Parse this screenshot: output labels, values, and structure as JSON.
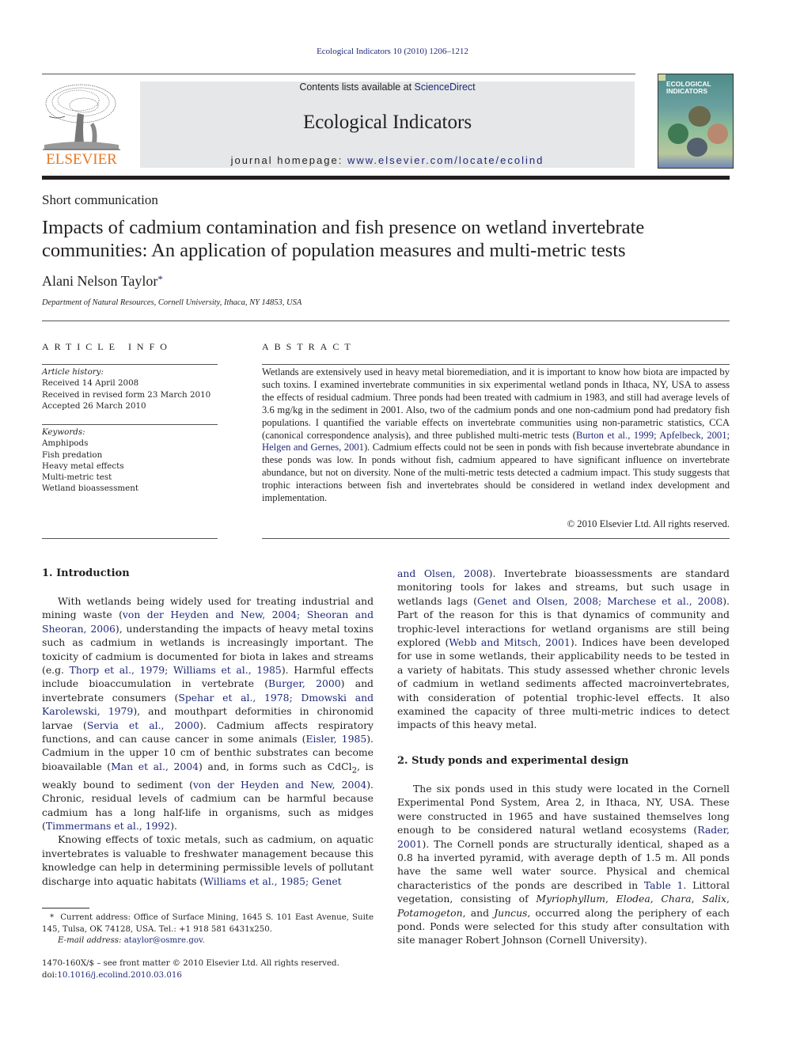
{
  "running_head": "Ecological Indicators 10 (2010) 1206–1212",
  "banner": {
    "publisher_logo_text": "ELSEVIER",
    "contents_prefix": "Contents lists available at ",
    "contents_link": "ScienceDirect",
    "journal_title": "Ecological Indicators",
    "homepage_prefix": "journal homepage: ",
    "homepage_url": "www.elsevier.com/locate/ecolind",
    "cover_title_line1": "ECOLOGICAL",
    "cover_title_line2": "INDICATORS"
  },
  "article": {
    "type": "Short communication",
    "title": "Impacts of cadmium contamination and fish presence on wetland invertebrate communities: An application of population measures and multi-metric tests",
    "author": "Alani Nelson Taylor",
    "author_mark": "*",
    "affiliation": "Department of Natural Resources, Cornell University, Ithaca, NY 14853, USA"
  },
  "article_info": {
    "heading": "ARTICLE INFO",
    "history_label": "Article history:",
    "history": [
      "Received 14 April 2008",
      "Received in revised form 23 March 2010",
      "Accepted 26 March 2010"
    ],
    "keywords_label": "Keywords:",
    "keywords": [
      "Amphipods",
      "Fish predation",
      "Heavy metal effects",
      "Multi-metric test",
      "Wetland bioassessment"
    ]
  },
  "abstract": {
    "heading": "ABSTRACT",
    "part1": "Wetlands are extensively used in heavy metal bioremediation, and it is important to know how biota are impacted by such toxins. I examined invertebrate communities in six experimental wetland ponds in Ithaca, NY, USA to assess the effects of residual cadmium. Three ponds had been treated with cadmium in 1983, and still had average levels of 3.6 mg/kg in the sediment in 2001. Also, two of the cadmium ponds and one non-cadmium pond had predatory fish populations. I quantified the variable effects on invertebrate communities using non-parametric statistics, CCA (canonical correspondence analysis), and three published multi-metric tests (",
    "cite1": "Burton et al., 1999; Apfelbeck, 2001; Helgen and Gernes, 2001",
    "part2": "). Cadmium effects could not be seen in ponds with fish because invertebrate abundance in these ponds was low. In ponds without fish, cadmium appeared to have significant influence on invertebrate abundance, but not on diversity. None of the multi-metric tests detected a cadmium impact. This study suggests that trophic interactions between fish and invertebrates should be considered in wetland index development and implementation.",
    "copyright": "© 2010 Elsevier Ltd. All rights reserved."
  },
  "section1": {
    "heading": "1.  Introduction",
    "p1": [
      {
        "t": "With wetlands being widely used for treating industrial and mining waste ("
      },
      {
        "c": "von der Heyden and New, 2004; Sheoran and Sheoran, 2006"
      },
      {
        "t": "), understanding the impacts of heavy metal toxins such as cadmium in wetlands is increasingly important. The toxicity of cadmium is documented for biota in lakes and streams (e.g. "
      },
      {
        "c": "Thorp et al., 1979; Williams et al., 1985"
      },
      {
        "t": "). Harmful effects include bioaccumulation in vertebrate ("
      },
      {
        "c": "Burger, 2000"
      },
      {
        "t": ") and invertebrate consumers ("
      },
      {
        "c": "Spehar et al., 1978; Dmowski and Karolewski, 1979"
      },
      {
        "t": "), and mouthpart deformities in chironomid larvae ("
      },
      {
        "c": "Servia et al., 2000"
      },
      {
        "t": "). Cadmium affects respiratory functions, and can cause cancer in some animals ("
      },
      {
        "c": "Eisler, 1985"
      },
      {
        "t": "). Cadmium in the upper 10 cm of benthic substrates can become bioavailable ("
      },
      {
        "c": "Man et al., 2004"
      },
      {
        "t": ") and, in forms such as CdCl"
      },
      {
        "sub": "2"
      },
      {
        "t": ", is weakly bound to sediment ("
      },
      {
        "c": "von der Heyden and New, 2004"
      },
      {
        "t": "). Chronic, residual levels of cadmium can be harmful because cadmium has a long half-life in organisms, such as midges ("
      },
      {
        "c": "Timmermans et al., 1992"
      },
      {
        "t": ")."
      }
    ],
    "p2": [
      {
        "t": "Knowing effects of toxic metals, such as cadmium, on aquatic invertebrates is valuable to freshwater management because this knowledge can help in determining permissible levels of pollutant discharge into aquatic habitats ("
      },
      {
        "c": "Williams et al., 1985; Genet"
      }
    ],
    "p2_cont": [
      {
        "c": "and Olsen, 2008"
      },
      {
        "t": "). Invertebrate bioassessments are standard monitoring tools for lakes and streams, but such usage in wetlands lags ("
      },
      {
        "c": "Genet and Olsen, 2008; Marchese et al., 2008"
      },
      {
        "t": "). Part of the reason for this is that dynamics of community and trophic-level interactions for wetland organisms are still being explored ("
      },
      {
        "c": "Webb and Mitsch, 2001"
      },
      {
        "t": "). Indices have been developed for use in some wetlands, their applicability needs to be tested in a variety of habitats. This study assessed whether chronic levels of cadmium in wetland sediments affected macroinvertebrates, with consideration of potential trophic-level effects. It also examined the capacity of three multi-metric indices to detect impacts of this heavy metal."
      }
    ]
  },
  "section2": {
    "heading": "2.  Study ponds and experimental design",
    "p1": [
      {
        "t": "The six ponds used in this study were located in the Cornell Experimental Pond System, Area 2, in Ithaca, NY, USA. These were constructed in 1965 and have sustained themselves long enough to be considered natural wetland ecosystems ("
      },
      {
        "c": "Rader, 2001"
      },
      {
        "t": "). The Cornell ponds are structurally identical, shaped as a 0.8 ha inverted pyramid, with average depth of 1.5 m. All ponds have the same well water source. Physical and chemical characteristics of the ponds are described in "
      },
      {
        "c": "Table 1"
      },
      {
        "t": ". Littoral vegetation, consisting of "
      },
      {
        "i": "Myriophyllum"
      },
      {
        "t": ", "
      },
      {
        "i": "Elodea"
      },
      {
        "t": ", "
      },
      {
        "i": "Chara"
      },
      {
        "t": ", "
      },
      {
        "i": "Salix"
      },
      {
        "t": ", "
      },
      {
        "i": "Potamogeton"
      },
      {
        "t": ", and "
      },
      {
        "i": "Juncus"
      },
      {
        "t": ", occurred along the periphery of each pond. Ponds were selected for this study after consultation with site manager Robert Johnson (Cornell University)."
      }
    ]
  },
  "footnote": {
    "mark": "*",
    "address": "Current address: Office of Surface Mining, 1645 S. 101 East Avenue, Suite 145, Tulsa, OK 74128, USA. Tel.: +1 918 581 6431x250.",
    "email_label": "E-mail address:",
    "email": "ataylor@osmre.gov",
    "issn_line": "1470-160X/$ – see front matter © 2010 Elsevier Ltd. All rights reserved.",
    "doi_prefix": "doi:",
    "doi": "10.1016/j.ecolind.2010.03.016"
  },
  "colors": {
    "link": "#1f2a7a",
    "elsevier_orange": "#e87722",
    "banner_bg": "#e6e7e8"
  }
}
